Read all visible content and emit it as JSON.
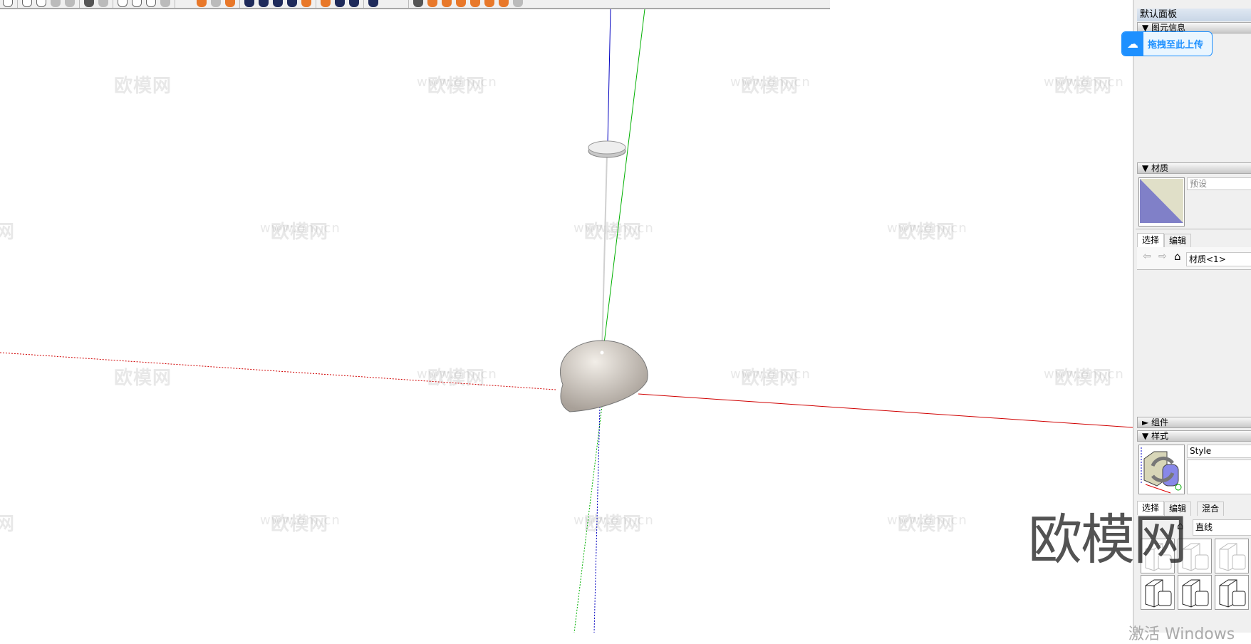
{
  "watermark": {
    "logo": "欧模网",
    "url": "www.om.cn",
    "big": "欧模网"
  },
  "panel": {
    "title": "默认面板",
    "entity_info": {
      "header": "图元信息"
    },
    "materials": {
      "header": "材质",
      "name_placeholder": "预设",
      "tabs": [
        "选择",
        "编辑"
      ],
      "library": "材质<1>",
      "swatch_colors": [
        "#8080c8",
        "#e0dfc8"
      ]
    },
    "components": {
      "header": "组件"
    },
    "styles": {
      "header": "样式",
      "name": "Style",
      "tabs": [
        "选择",
        "编辑",
        "混合"
      ],
      "library": "直线"
    }
  },
  "upload_button": {
    "label": "拖拽至此上传"
  },
  "os_notice": "激活 Windows",
  "axis_colors": {
    "red": "#d00000",
    "green": "#00b000",
    "blue": "#0000c0"
  }
}
